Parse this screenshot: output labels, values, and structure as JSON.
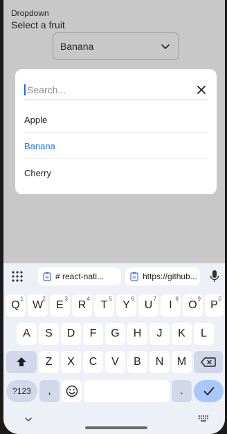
{
  "app": {
    "label": "Dropdown",
    "title": "Select a fruit",
    "selected_value": "Banana"
  },
  "modal": {
    "search_placeholder": "Search...",
    "options": [
      {
        "label": "Apple",
        "selected": false
      },
      {
        "label": "Banana",
        "selected": true
      },
      {
        "label": "Cherry",
        "selected": false
      }
    ]
  },
  "keyboard": {
    "suggestions": [
      "# react-nati...",
      "https://github..."
    ],
    "row1": [
      {
        "key": "Q",
        "hint": "1"
      },
      {
        "key": "W",
        "hint": "2"
      },
      {
        "key": "E",
        "hint": "3"
      },
      {
        "key": "R",
        "hint": "4"
      },
      {
        "key": "T",
        "hint": "5"
      },
      {
        "key": "Y",
        "hint": "6"
      },
      {
        "key": "U",
        "hint": "7"
      },
      {
        "key": "I",
        "hint": "8"
      },
      {
        "key": "O",
        "hint": "9"
      },
      {
        "key": "P",
        "hint": "0"
      }
    ],
    "row2": [
      "A",
      "S",
      "D",
      "F",
      "G",
      "H",
      "J",
      "K",
      "L"
    ],
    "row3": [
      "Z",
      "X",
      "C",
      "V",
      "B",
      "N",
      "M"
    ],
    "symbols_label": "?123",
    "comma": ",",
    "period": "."
  },
  "colors": {
    "accent": "#1a73e8",
    "overlay_bg": "#c8c8c8",
    "keyboard_bg": "#eef0f7",
    "enter_key": "#a8c7fa"
  }
}
